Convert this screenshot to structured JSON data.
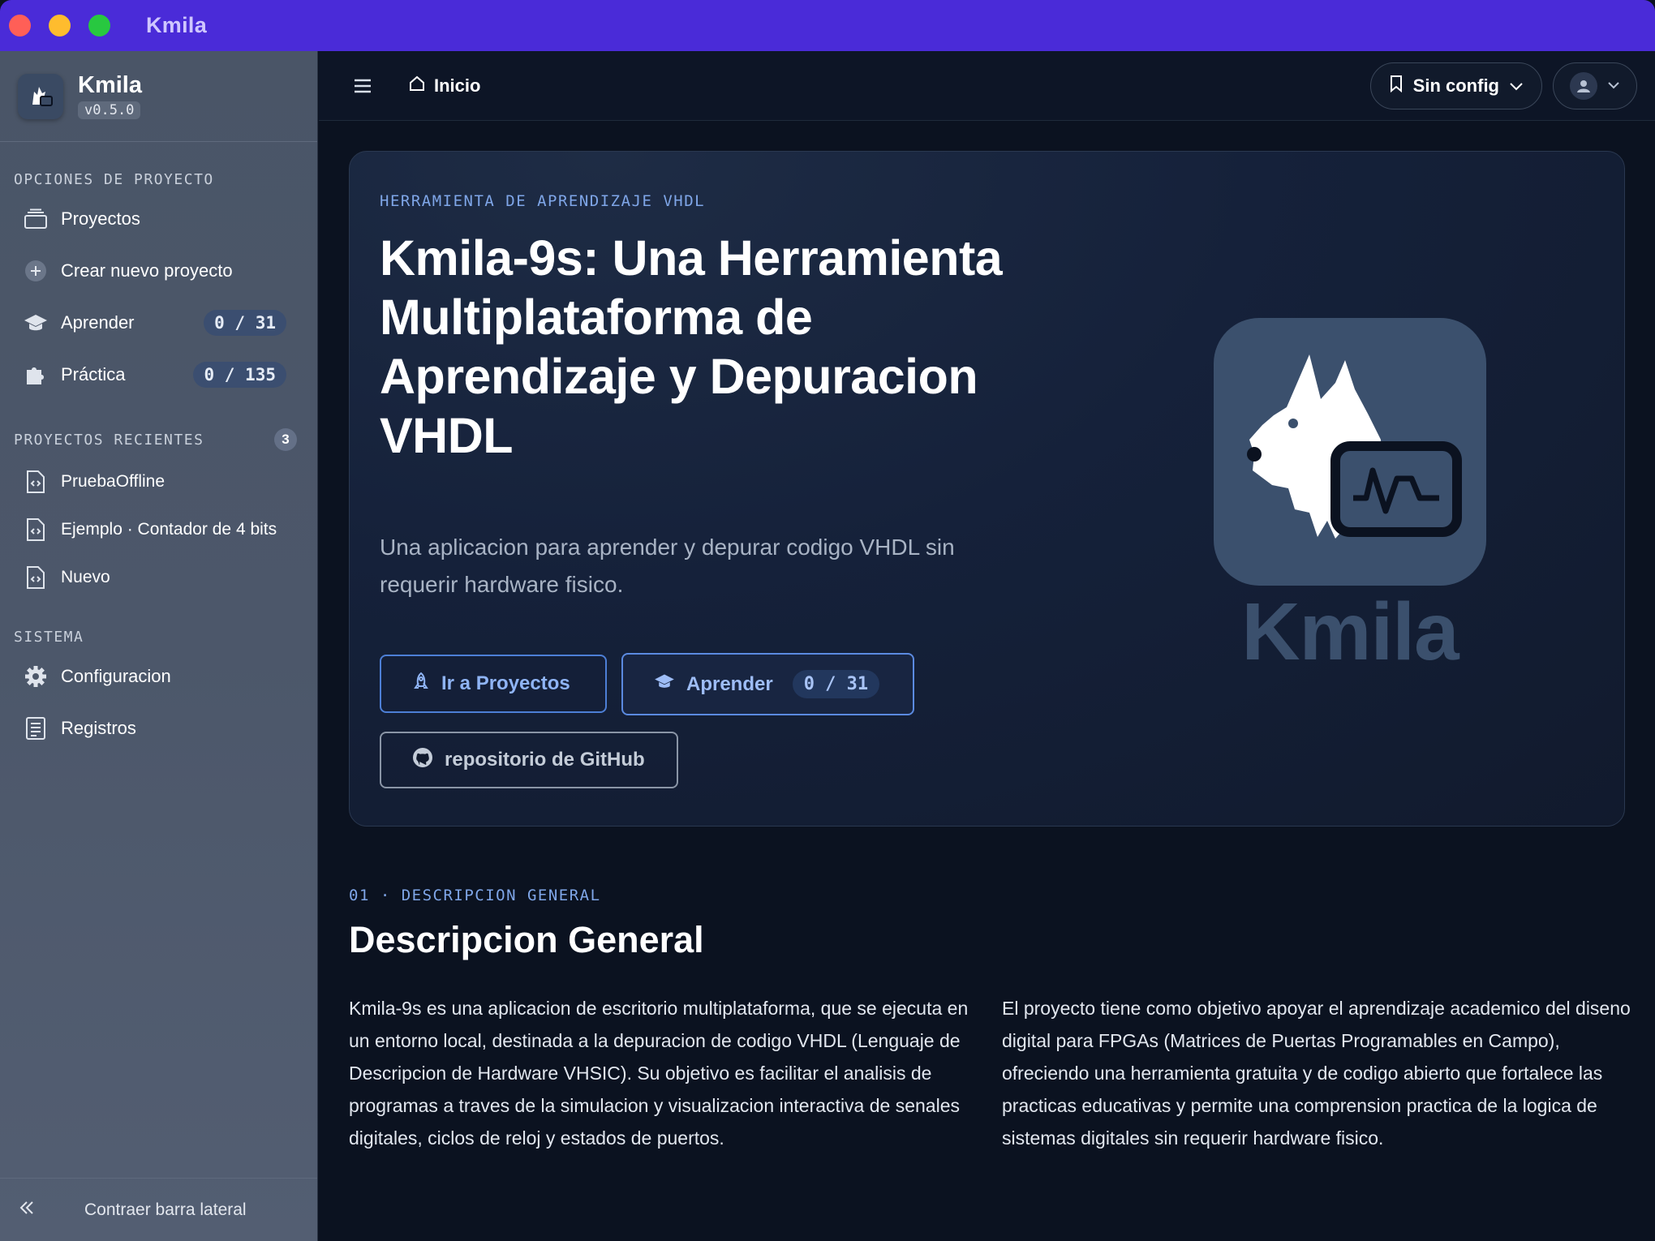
{
  "window": {
    "title": "Kmila"
  },
  "sidebar": {
    "brand": {
      "name": "Kmila",
      "version": "v0.5.0"
    },
    "sections": {
      "project": "OPCIONES DE PROYECTO",
      "recent": "PROYECTOS RECIENTES",
      "recent_count": "3",
      "system": "SISTEMA"
    },
    "project_items": [
      {
        "label": "Proyectos",
        "icon": "folders-icon"
      },
      {
        "label": "Crear nuevo proyecto",
        "icon": "plus-circle-icon"
      },
      {
        "label": "Aprender",
        "icon": "graduation-cap-icon",
        "badge": "0 / 31"
      },
      {
        "label": "Práctica",
        "icon": "puzzle-icon",
        "badge": "0 / 135"
      }
    ],
    "recent_items": [
      {
        "label": "PruebaOffline",
        "icon": "code-file-icon"
      },
      {
        "label": "Ejemplo · Contador de 4 bits",
        "icon": "code-file-icon"
      },
      {
        "label": "Nuevo",
        "icon": "code-file-icon"
      }
    ],
    "system_items": [
      {
        "label": "Configuracion",
        "icon": "gear-icon"
      },
      {
        "label": "Registros",
        "icon": "log-icon"
      }
    ],
    "collapse_label": "Contraer barra lateral"
  },
  "topbar": {
    "breadcrumb": "Inicio",
    "config_label": "Sin config"
  },
  "hero": {
    "kicker": "HERRAMIENTA DE APRENDIZAJE VHDL",
    "title": "Kmila-9s: Una Herramienta Multiplataforma de Aprendizaje y Depuracion VHDL",
    "subtitle": "Una aplicacion para aprender y depurar codigo VHDL sin requerir hardware fisico.",
    "btn_projects": "Ir a Proyectos",
    "btn_learn": "Aprender",
    "btn_learn_badge": "0 / 31",
    "btn_github": "repositorio de GitHub",
    "logo_word": "Kmila"
  },
  "overview": {
    "kicker": "01 · DESCRIPCION GENERAL",
    "title": "Descripcion General",
    "paragraph_1": "Kmila-9s es una aplicacion de escritorio multiplataforma, que se ejecuta en un entorno local, destinada a la depuracion de codigo VHDL (Lenguaje de Descripcion de Hardware VHSIC). Su objetivo es facilitar el analisis de programas a traves de la simulacion y visualizacion interactiva de senales digitales, ciclos de reloj y estados de puertos.",
    "paragraph_2": "El proyecto tiene como objetivo apoyar el aprendizaje academico del diseno digital para FPGAs (Matrices de Puertas Programables en Campo), ofreciendo una herramienta gratuita y de codigo abierto que fortalece las practicas educativas y permite una comprension practica de la logica de sistemas digitales sin requerir hardware fisico."
  },
  "colors": {
    "titlebar": "#4a2bd8",
    "accent": "#7fa6e8",
    "background": "#0b1220",
    "sidebar": "#4c576a"
  }
}
